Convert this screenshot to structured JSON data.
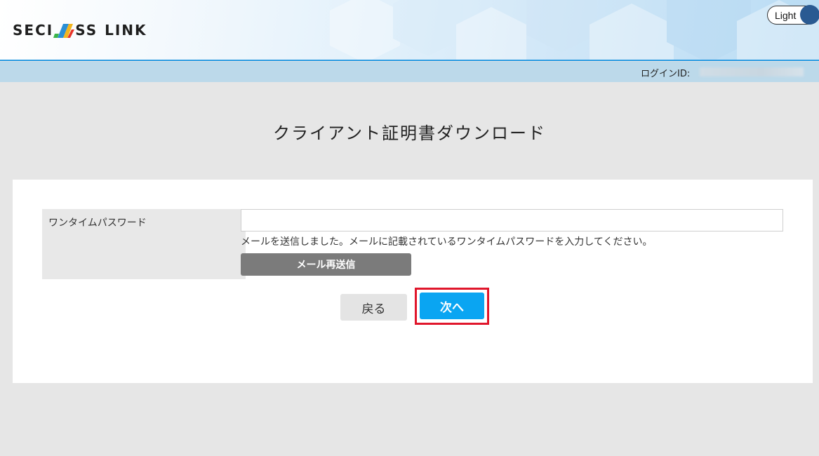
{
  "header": {
    "brand_left": "SECI",
    "brand_right": "SS",
    "brand_link": "LINK",
    "theme_toggle_label": "Light",
    "colors": {
      "header_accent": "#2a9be2",
      "login_bar_bg": "#bcd9ea"
    }
  },
  "login_bar": {
    "label": "ログインID:"
  },
  "page": {
    "title": "クライアント証明書ダウンロード"
  },
  "form": {
    "otp_label": "ワンタイムパスワード",
    "otp_value": "",
    "otp_placeholder": "",
    "hint": "メールを送信しました。メールに記載されているワンタイムパスワードを入力してください。",
    "resend_button_label": "メール再送信"
  },
  "actions": {
    "back_label": "戻る",
    "next_label": "次へ",
    "next_color": "#0aa5f2",
    "highlight_color": "#e0162b"
  }
}
